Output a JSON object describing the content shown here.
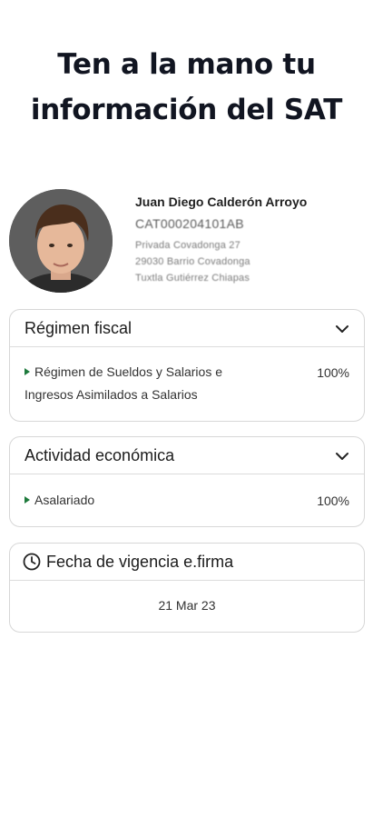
{
  "headline": {
    "line1": "Ten a la mano tu",
    "line2": "información del SAT"
  },
  "profile": {
    "name": "Juan Diego Calderón Arroyo",
    "rfc": "CAT000204101AB",
    "address_line1": "Privada Covadonga 27",
    "address_line2": "29030 Barrio Covadonga",
    "address_line3": "Tuxtla Gutiérrez Chiapas"
  },
  "regimen": {
    "title": "Régimen fiscal",
    "icon": "chevron-down-icon",
    "item_line1": "Régimen de Sueldos y Salarios e",
    "item_line2": "Ingresos Asimilados a Salarios",
    "percent": "100%"
  },
  "actividad": {
    "title": "Actividad económica",
    "icon": "chevron-down-icon",
    "item": "Asalariado",
    "percent": "100%"
  },
  "vigencia": {
    "title": "Fecha de vigencia e.firma",
    "icon": "clock-icon",
    "date": "21 Mar 23"
  },
  "colors": {
    "bullet": "#1e7a3c",
    "headline": "#111521",
    "border": "#d7d7d7"
  }
}
